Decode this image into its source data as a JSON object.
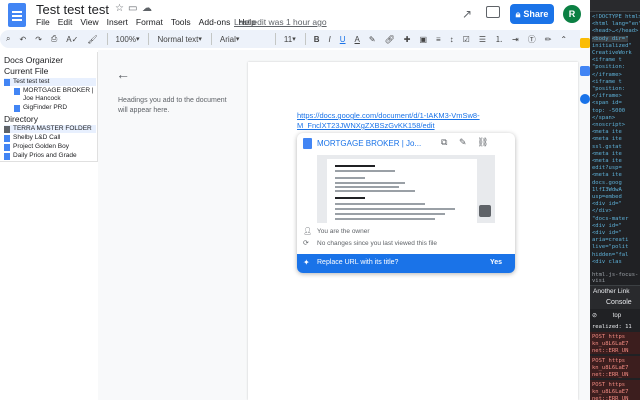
{
  "header": {
    "title": "Test test test",
    "menu": [
      "File",
      "Edit",
      "View",
      "Insert",
      "Format",
      "Tools",
      "Add-ons",
      "Help"
    ],
    "last_edit": "Last edit was 1 hour ago",
    "share_label": "Share",
    "avatar_letter": "R",
    "brand_color": "#1a73e8"
  },
  "toolbar": {
    "zoom": "100%",
    "style": "Normal text",
    "font": "Arial",
    "size": "11"
  },
  "organizer": {
    "title": "Docs Organizer",
    "current_file_header": "Current File",
    "current_items": [
      "Test test test",
      "MORTGAGE BROKER | Joe Hancock",
      "GigFinder PRD"
    ],
    "directory_header": "Directory",
    "directory_items": [
      "TERRA MASTER FOLDER",
      "Shelby L&D Call",
      "Project Golden Boy",
      "Daily Prios and Grade"
    ]
  },
  "outline": {
    "hint": "Headings you add to the document will appear here."
  },
  "document": {
    "link": "https://docs.google.com/document/d/1-IAKM3-VmSw8-M_FnclXT23JWNXgZXBSzGvKK158/edit"
  },
  "chip": {
    "title": "MORTGAGE BROKER | Jo...",
    "owner": "You are the owner",
    "changes": "No changes since you last viewed this file",
    "replace_prompt": "Replace URL with its title?",
    "replace_yes": "Yes"
  },
  "devtools": {
    "lines": [
      "<!DOCTYPE html>",
      "<html lang=\"en\"",
      "<head>…</head>",
      "<body dir=\"",
      "initialized\"",
      "CreativeWork",
      "<iframe t",
      "\"position:",
      "</iframe>",
      "<iframe t",
      "\"position:",
      "</iframe>",
      "<span id=",
      "top: -5000",
      "</span>",
      "<noscript>",
      "<meta ite",
      "<meta ite",
      "ssl.gstat",
      "<meta ite",
      "<meta ite",
      "edit?usp=",
      "<meta ite",
      "docs.goog",
      "1lfI3WdwA",
      "usp=embed",
      "<div id=\"",
      "</div>",
      "\"docs-mater",
      "<div id=\"",
      "<div id=\"",
      "aria=creati",
      "live=\"polit",
      "hidden=\"fal",
      "<div clas"
    ],
    "breadcrumb": "html.js-focus-visi",
    "another_link": "Another Link",
    "console_tab": "Console",
    "context": "top",
    "log_lines": [
      "realized: 11",
      "POST https",
      "kn_u8L6LaE7",
      "net::ERR_UN",
      "POST https",
      "kn_u8L6LaE7",
      "net::ERR_UN",
      "POST https",
      "kn_u8L6LaE7",
      "net::ERR_UN"
    ]
  }
}
